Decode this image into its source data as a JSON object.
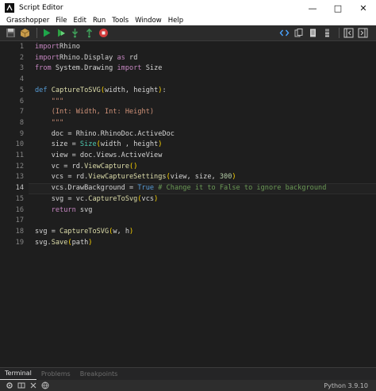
{
  "window": {
    "title": "Script Editor"
  },
  "menu": [
    "Grasshopper",
    "File",
    "Edit",
    "Run",
    "Tools",
    "Window",
    "Help"
  ],
  "editor": {
    "current_line": 14,
    "lines": [
      [
        [
          "kw2",
          "import"
        ],
        [
          "",
          "Rhino"
        ]
      ],
      [
        [
          "kw2",
          "import"
        ],
        [
          "",
          "Rhino.Display "
        ],
        [
          "kw2",
          "as"
        ],
        [
          "",
          " rd"
        ]
      ],
      [
        [
          "kw2",
          "from"
        ],
        [
          "",
          " System.Drawing "
        ],
        [
          "kw2",
          "import"
        ],
        [
          "",
          " Size"
        ]
      ],
      [],
      [
        [
          "kw",
          "def"
        ],
        [
          "",
          " "
        ],
        [
          "fn",
          "CaptureToSVG"
        ],
        [
          "par",
          "("
        ],
        [
          "",
          "width, height"
        ],
        [
          "par",
          ")"
        ],
        [
          "",
          ":"
        ]
      ],
      [
        [
          "",
          ""
        ],
        [
          "str",
          "    \"\"\""
        ]
      ],
      [
        [
          "str",
          "    (Int: Width, Int: Height)"
        ]
      ],
      [
        [
          "str",
          "    \"\"\""
        ]
      ],
      [
        [
          "",
          "    doc = Rhino.RhinoDoc.ActiveDoc"
        ]
      ],
      [
        [
          "",
          "    size = "
        ],
        [
          "cls",
          "Size"
        ],
        [
          "par",
          "("
        ],
        [
          "",
          "width , height"
        ],
        [
          "par",
          ")"
        ]
      ],
      [
        [
          "",
          "    view = doc.Views.ActiveView"
        ]
      ],
      [
        [
          "",
          "    vc = rd."
        ],
        [
          "fn",
          "ViewCapture"
        ],
        [
          "par",
          "()"
        ]
      ],
      [
        [
          "",
          "    vcs = rd."
        ],
        [
          "fn",
          "ViewCaptureSettings"
        ],
        [
          "par",
          "("
        ],
        [
          "",
          "view, size, "
        ],
        [
          "num",
          "300"
        ],
        [
          "par",
          ")"
        ]
      ],
      [
        [
          "",
          "    vcs.DrawBackground = "
        ],
        [
          "kw",
          "True"
        ],
        [
          "",
          " "
        ],
        [
          "cmt",
          "# Change it to False to ignore background"
        ]
      ],
      [
        [
          "",
          "    svg = vc."
        ],
        [
          "fn",
          "CaptureToSvg"
        ],
        [
          "par",
          "("
        ],
        [
          "",
          "vcs"
        ],
        [
          "par",
          ")"
        ]
      ],
      [
        [
          "kw2",
          "    return"
        ],
        [
          "",
          " svg"
        ]
      ],
      [],
      [
        [
          "",
          "svg = "
        ],
        [
          "fn",
          "CaptureToSVG"
        ],
        [
          "par",
          "("
        ],
        [
          "",
          "w, h"
        ],
        [
          "par",
          ")"
        ]
      ],
      [
        [
          "",
          "svg."
        ],
        [
          "fn",
          "Save"
        ],
        [
          "par",
          "("
        ],
        [
          "",
          "path"
        ],
        [
          "par",
          ")"
        ]
      ]
    ]
  },
  "panel": {
    "tabs": [
      "Terminal",
      "Problems",
      "Breakpoints"
    ],
    "active": "Terminal"
  },
  "status": {
    "python": "Python 3.9.10"
  }
}
